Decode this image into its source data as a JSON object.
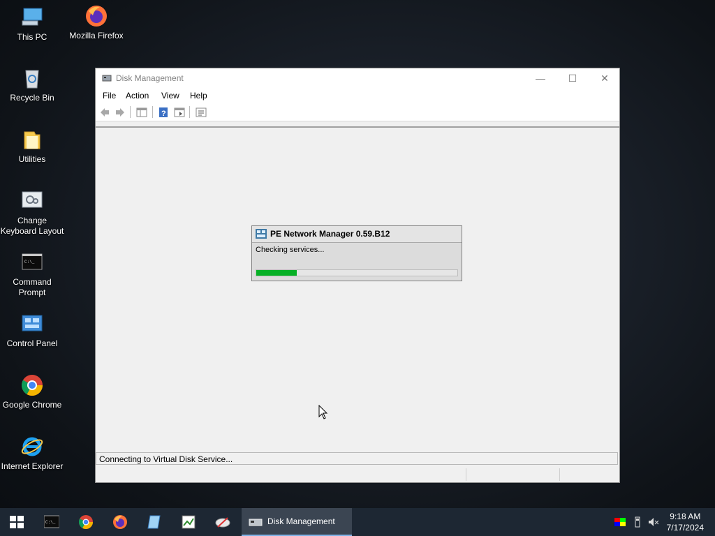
{
  "desktop": {
    "icons": [
      {
        "label": "This PC",
        "icon": "this-pc-icon"
      },
      {
        "label": "Mozilla Firefox",
        "icon": "firefox-icon"
      },
      {
        "label": "Recycle Bin",
        "icon": "recycle-bin-icon"
      },
      {
        "label": "Utilities",
        "icon": "folder-icon"
      },
      {
        "label": "Change Keyboard Layout",
        "icon": "keyboard-settings-icon"
      },
      {
        "label": "Command Prompt",
        "icon": "cmd-icon"
      },
      {
        "label": "Control Panel",
        "icon": "control-panel-icon"
      },
      {
        "label": "Google Chrome",
        "icon": "chrome-icon"
      },
      {
        "label": "Internet Explorer",
        "icon": "ie-icon"
      }
    ]
  },
  "window": {
    "title": "Disk Management",
    "menu": [
      "File",
      "Action",
      "View",
      "Help"
    ],
    "toolbar": [
      "back-icon",
      "forward-icon",
      "show-hide-console-tree-icon",
      "help-icon",
      "show-action-pane-icon",
      "properties-icon"
    ],
    "status_text": "Connecting to Virtual Disk Service..."
  },
  "popup": {
    "title": "PE Network Manager 0.59.B12",
    "message": "Checking services...",
    "progress": 0.2,
    "progress_color": "#06b025"
  },
  "taskbar": {
    "active_task": "Disk Management",
    "pinned": [
      "start-icon",
      "cmd-icon",
      "chrome-icon",
      "firefox-icon",
      "notepad-icon",
      "image-editor-icon",
      "snipping-tool-icon"
    ],
    "time": "9:18 AM",
    "date": "7/17/2024"
  },
  "colors": {
    "accent": "#7fb2e6",
    "taskbar": "#1d2733"
  }
}
